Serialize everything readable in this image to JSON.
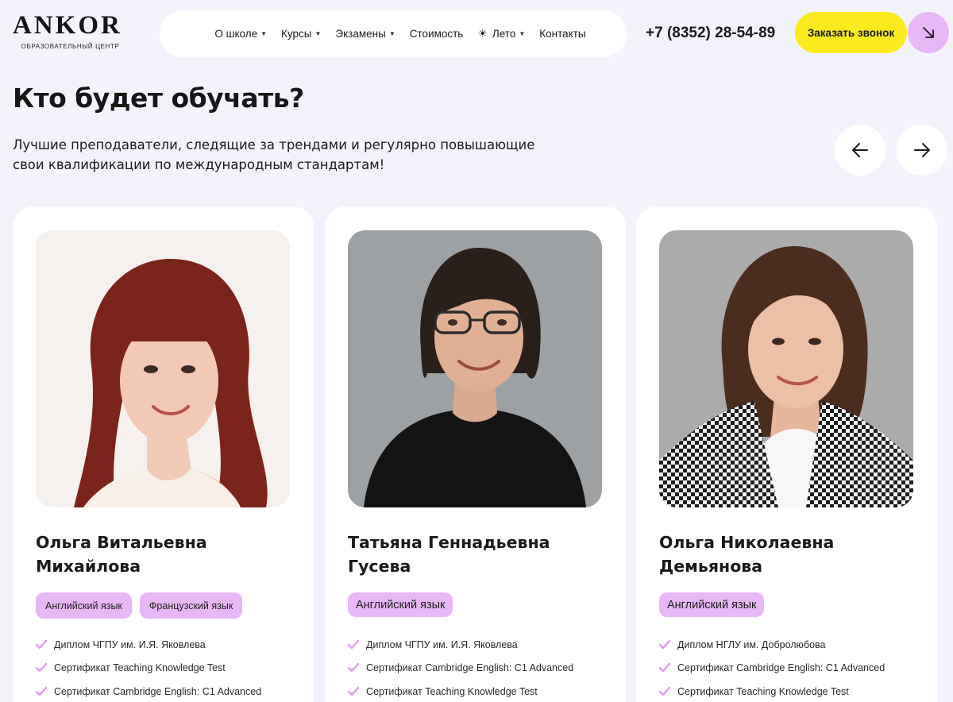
{
  "header": {
    "logo": {
      "name": "ANKOR",
      "tagline": "ОБРАЗОВАТЕЛЬНЫЙ ЦЕНТР"
    },
    "nav": [
      {
        "label": "О школе",
        "dropdown": true
      },
      {
        "label": "Курсы",
        "dropdown": true
      },
      {
        "label": "Экзамены",
        "dropdown": true
      },
      {
        "label": "Стоимость",
        "dropdown": false
      },
      {
        "label": "Лето",
        "dropdown": true,
        "icon": "sun-icon"
      },
      {
        "label": "Контакты",
        "dropdown": false
      }
    ],
    "phone": "+7 (8352) 28-54-89",
    "cta_label": "Заказать звонок",
    "cta_icon": "arrow-down-right-icon"
  },
  "section": {
    "title": "Кто будет обучать?",
    "subtitle": "Лучшие преподаватели, следящие за трендами и регулярно повышающие свои квалификации по международным стандартам!",
    "prev_icon": "arrow-left-icon",
    "next_icon": "arrow-right-icon"
  },
  "teachers": [
    {
      "name_line1": "Ольга Витальевна",
      "name_line2": "Михайлова",
      "tags": [
        "Английский язык",
        "Французский язык"
      ],
      "credentials": [
        "Диплом ЧГПУ им. И.Я. Яковлева",
        "Сертификат Teaching Knowledge Test",
        "Сертификат Cambridge English: C1 Advanced"
      ]
    },
    {
      "name_line1": "Татьяна Геннадьевна",
      "name_line2": "Гусева",
      "tags": [
        "Английский язык"
      ],
      "credentials": [
        "Диплом ЧГПУ им. И.Я. Яковлева",
        "Сертификат Cambridge English: C1 Advanced",
        "Сертификат Teaching Knowledge Test"
      ]
    },
    {
      "name_line1": "Ольга Николаевна",
      "name_line2": "Демьянова",
      "tags": [
        "Английский язык"
      ],
      "credentials": [
        "Диплом НГЛУ им. Добролюбова",
        "Сертификат Cambridge English: C1 Advanced",
        "Сертификат Teaching Knowledge Test"
      ]
    }
  ],
  "colors": {
    "background": "#f3f4fb",
    "accent_yellow": "#fbea1d",
    "accent_lilac": "#e7b7f6",
    "card": "#ffffff"
  }
}
